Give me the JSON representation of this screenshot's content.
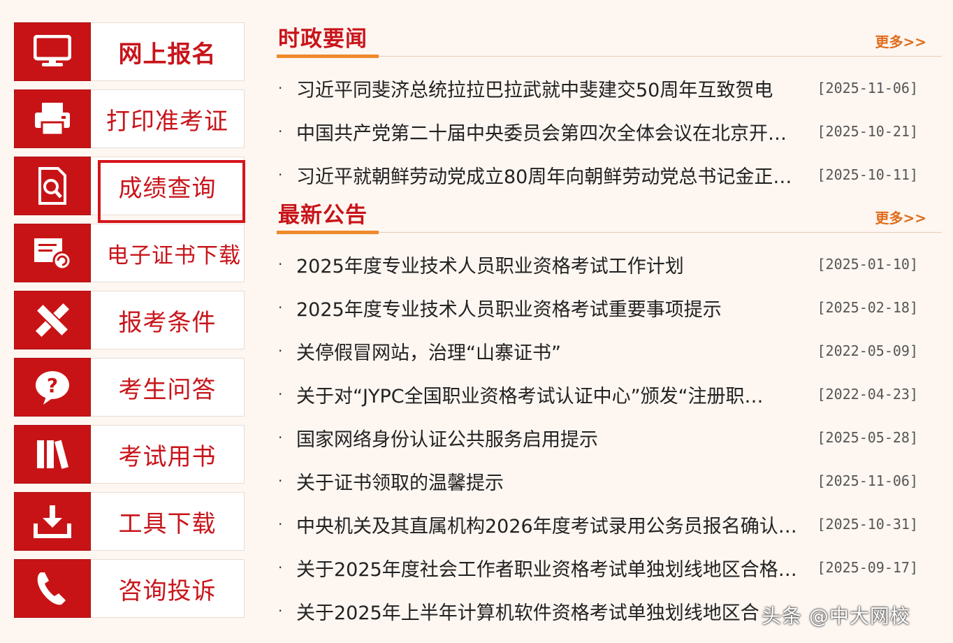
{
  "menu": {
    "items": [
      {
        "label": "网上报名",
        "icon": "monitor-icon"
      },
      {
        "label": "打印准考证",
        "icon": "printer-icon"
      },
      {
        "label": "成绩查询",
        "icon": "document-search-icon"
      },
      {
        "label": "电子证书下载",
        "icon": "certificate-download-icon"
      },
      {
        "label": "报考条件",
        "icon": "pencil-ruler-icon"
      },
      {
        "label": "考生问答",
        "icon": "question-bubble-icon"
      },
      {
        "label": "考试用书",
        "icon": "books-icon"
      },
      {
        "label": "工具下载",
        "icon": "download-tray-icon"
      },
      {
        "label": "咨询投诉",
        "icon": "phone-icon"
      }
    ]
  },
  "news": {
    "title": "时政要闻",
    "more": "更多>>",
    "items": [
      {
        "title": "习近平同斐济总统拉拉巴拉武就中斐建交50周年互致贺电",
        "date": "[2025-11-06]"
      },
      {
        "title": "中国共产党第二十届中央委员会第四次全体会议在北京开…",
        "date": "[2025-10-21]"
      },
      {
        "title": "习近平就朝鲜劳动党成立80周年向朝鲜劳动党总书记金正…",
        "date": "[2025-10-11]"
      }
    ]
  },
  "notices": {
    "title": "最新公告",
    "more": "更多>>",
    "items": [
      {
        "title": "2025年度专业技术人员职业资格考试工作计划",
        "date": "[2025-01-10]"
      },
      {
        "title": "2025年度专业技术人员职业资格考试重要事项提示",
        "date": "[2025-02-18]"
      },
      {
        "title": "关停假冒网站，治理“山寨证书”",
        "date": "[2022-05-09]"
      },
      {
        "title": "关于对“JYPC全国职业资格考试认证中心”颁发“注册职…",
        "date": "[2022-04-23]"
      },
      {
        "title": "国家网络身份认证公共服务启用提示",
        "date": "[2025-05-28]"
      },
      {
        "title": "关于证书领取的温馨提示",
        "date": "[2025-11-06]"
      },
      {
        "title": "中央机关及其直属机构2026年度考试录用公务员报名确认…",
        "date": "[2025-10-31]"
      },
      {
        "title": "关于2025年度社会工作者职业资格考试单独划线地区合格…",
        "date": "[2025-09-17]"
      },
      {
        "title": "关于2025年上半年计算机软件资格考试单独划线地区合",
        "date": ""
      }
    ]
  },
  "watermark": "头条 @中大网校",
  "colors": {
    "accent": "#c8141a",
    "underline": "#ef8a2a",
    "more": "#e06d1b"
  }
}
